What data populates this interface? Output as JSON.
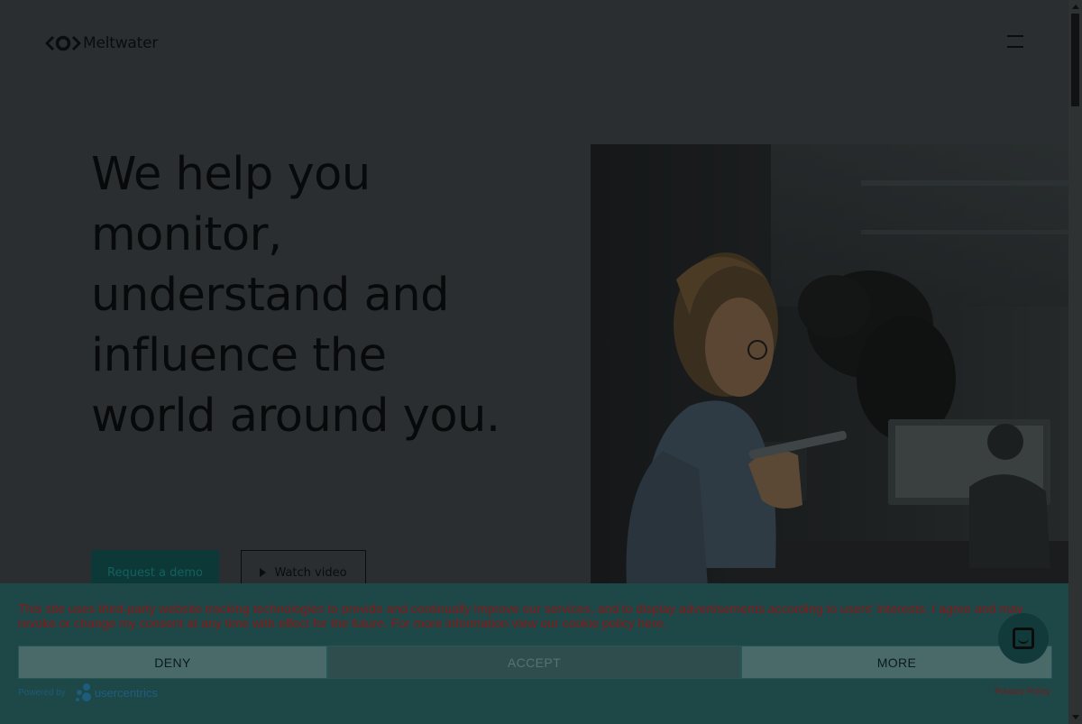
{
  "header": {
    "brand": "Meltwater",
    "logo_icon": "meltwater-logo-icon",
    "menu_icon": "hamburger-menu-icon"
  },
  "hero": {
    "headline": "We help you monitor, understand and influence the world around you.",
    "cta_primary": "Request a demo",
    "cta_secondary": "Watch video",
    "video_icon": "play-icon"
  },
  "cookie_banner": {
    "text": "This site uses third-party website tracking technologies to provide and continually improve our services, and to display advertisements according to users' interests. I agree and may revoke or change my consent at any time with effect for the future.",
    "link_text": "For more information view our cookie policy here.",
    "deny_label": "DENY",
    "accept_label": "ACCEPT",
    "more_label": "MORE",
    "powered_by": "Powered by",
    "provider": "usercentrics",
    "privacy_policy": "Privacy Policy"
  },
  "chat": {
    "icon": "chat-icon"
  },
  "colors": {
    "page_bg": "#2b2e30",
    "banner_bg": "#1e4747",
    "banner_text": "#8b1717",
    "cta_bg": "#0c3837"
  }
}
